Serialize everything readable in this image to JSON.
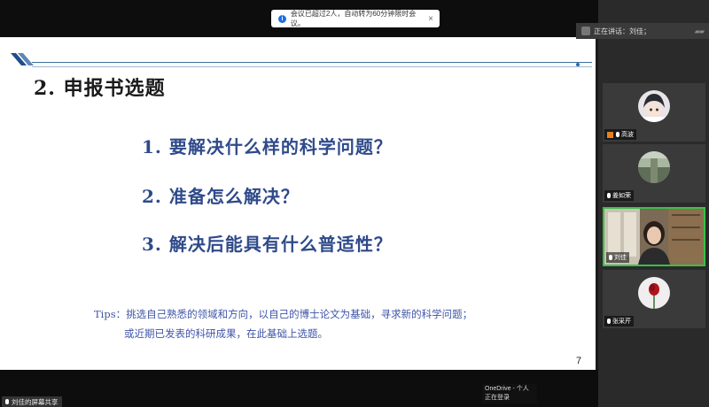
{
  "notification": {
    "text": "会议已超过2人，自动转为60分钟限时会议。",
    "close": "×"
  },
  "speaker": {
    "label": "正在讲话：刘佳；"
  },
  "slide": {
    "title": "2. 申报书选题",
    "questions": [
      "1. 要解决什么样的科学问题？",
      "2. 准备怎么解决？",
      "3. 解决后能具有什么普适性？"
    ],
    "tips_line1": "Tips：挑选自己熟悉的领域和方向，以自己的博士论文为基础，寻求新的科学问题；",
    "tips_line2": "或近期已发表的科研成果，在此基础上选题。",
    "page_number": "7"
  },
  "participants": [
    {
      "name": "高波",
      "active": false
    },
    {
      "name": "姜如荣",
      "active": false
    },
    {
      "name": "刘佳",
      "active": true
    },
    {
      "name": "张采芹",
      "active": false
    }
  ],
  "share_status": "刘佳的屏幕共享",
  "onedrive": {
    "title": "OneDrive - 个人",
    "status": "正在登录"
  }
}
